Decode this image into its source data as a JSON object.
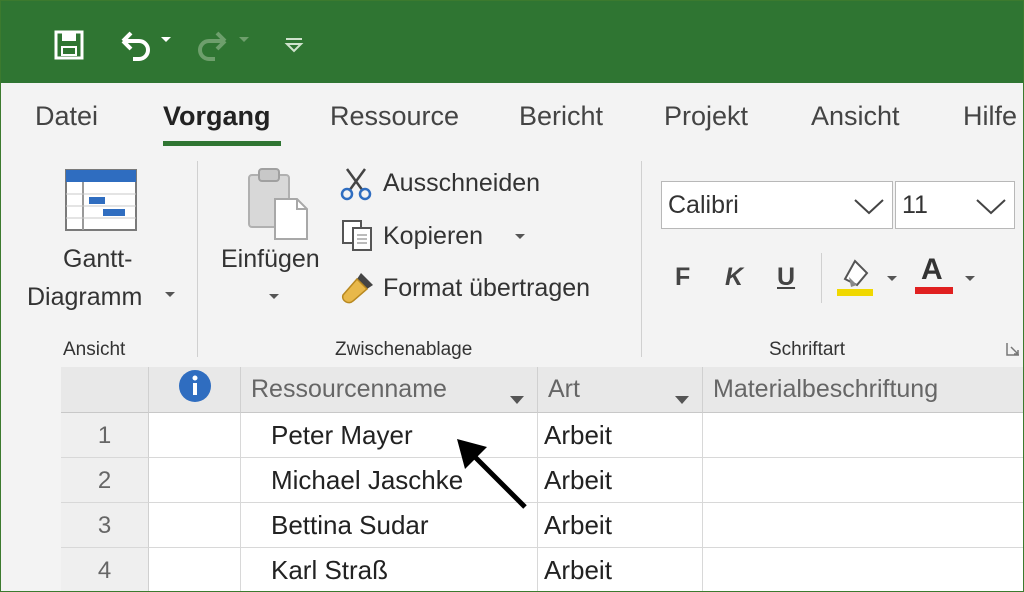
{
  "colors": {
    "accent": "#2f7532",
    "info": "#2f6dc0",
    "highlight_yellow": "#f0d800",
    "font_red": "#e02020"
  },
  "quick_access": {
    "icons": [
      "save-icon",
      "undo-icon",
      "redo-icon",
      "customize-icon"
    ]
  },
  "tabs": [
    {
      "label": "Datei"
    },
    {
      "label": "Vorgang",
      "active": true
    },
    {
      "label": "Ressource"
    },
    {
      "label": "Bericht"
    },
    {
      "label": "Projekt"
    },
    {
      "label": "Ansicht"
    },
    {
      "label": "Hilfe"
    }
  ],
  "ribbon": {
    "ansicht": {
      "label": "Ansicht",
      "gantt_line1": "Gantt-",
      "gantt_line2": "Diagramm"
    },
    "zwischenablage": {
      "label": "Zwischenablage",
      "einfuegen": "Einfügen",
      "ausschneiden": "Ausschneiden",
      "kopieren": "Kopieren",
      "format": "Format übertragen"
    },
    "schriftart": {
      "label": "Schriftart",
      "font": "Calibri",
      "size": "11",
      "bold": "F",
      "italic": "K",
      "underline": "U",
      "font_color_letter": "A"
    }
  },
  "table": {
    "columns": [
      "Ressourcenname",
      "Art",
      "Materialbeschriftung"
    ],
    "rows": [
      {
        "num": "1",
        "name": "Peter Mayer",
        "type": "Arbeit"
      },
      {
        "num": "2",
        "name": "Michael Jaschke",
        "type": "Arbeit"
      },
      {
        "num": "3",
        "name": "Bettina Sudar",
        "type": "Arbeit"
      },
      {
        "num": "4",
        "name": "Karl Straß",
        "type": "Arbeit"
      }
    ]
  }
}
